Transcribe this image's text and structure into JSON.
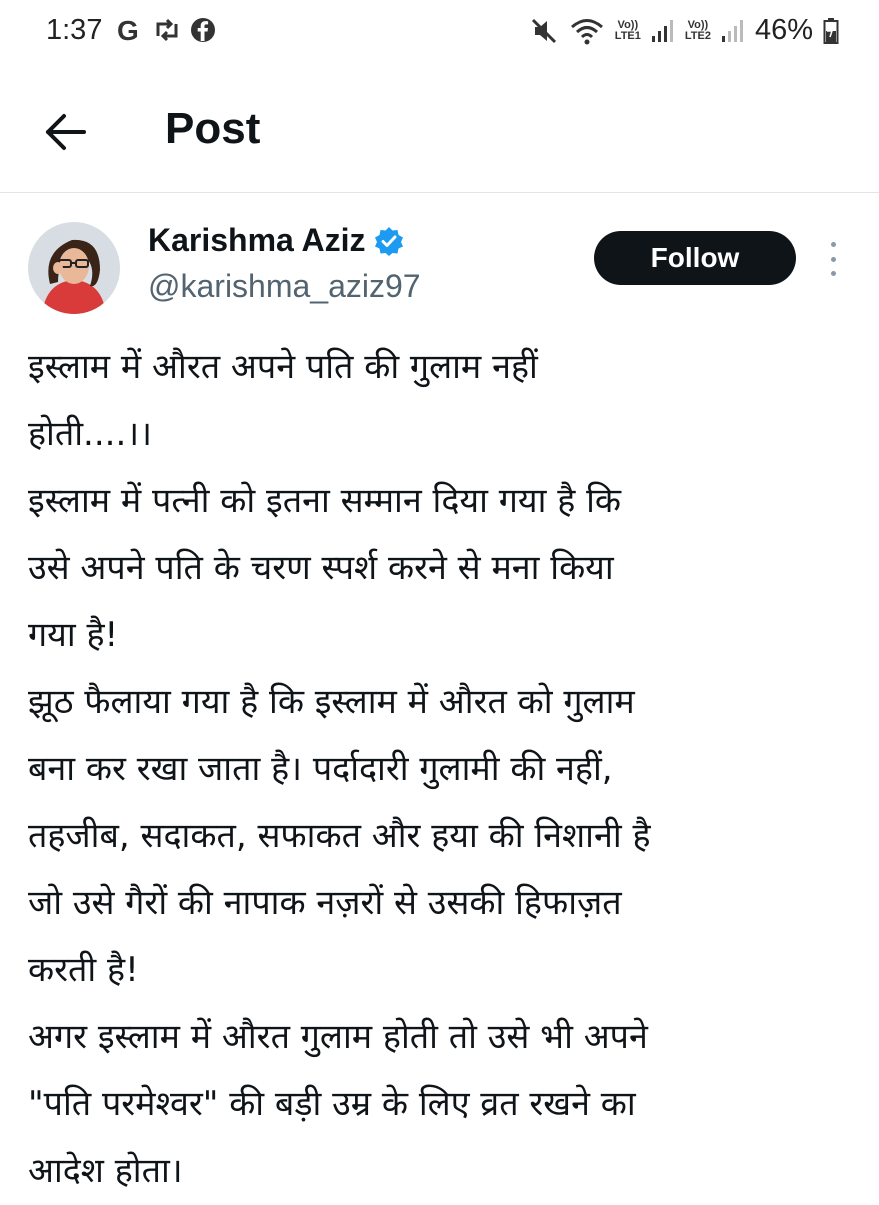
{
  "status_bar": {
    "time": "1:37",
    "left_icons": [
      "google-icon",
      "sync-icon",
      "facebook-icon"
    ],
    "lte1": [
      "Vo))",
      "LTE1"
    ],
    "lte2": [
      "Vo))",
      "LTE2"
    ],
    "battery": "46%"
  },
  "header": {
    "title": "Post"
  },
  "author": {
    "name": "Karishma Aziz",
    "handle": "@karishma_aziz97",
    "verified": true
  },
  "follow_label": "Follow",
  "post_lines": [
    "इस्लाम में औरत अपने पति की गुलाम नहीं",
    "होती....।।",
    "इस्लाम में पत्नी को इतना सम्मान दिया गया है कि",
    "उसे अपने पति के चरण स्पर्श करने से मना किया",
    "गया है!",
    "झूठ फैलाया गया है कि इस्लाम में औरत को गुलाम",
    "बना कर रखा जाता है। पर्दादारी गुलामी की नहीं,",
    "तहजीब, सदाकत, सफाकत और हया की निशानी है",
    "जो उसे गैरों की नापाक नज़रों से उसकी हिफाज़त",
    "करती है!",
    "अगर इस्लाम में औरत गुलाम होती तो उसे भी अपने",
    "\"पति परमेश्वर\" की बड़ी उम्र के लिए व्रत रखने का",
    "आदेश होता।"
  ],
  "colors": {
    "text": "#0f1419",
    "secondary": "#536471",
    "verified": "#1d9bf0",
    "follow_bg": "#0f1419"
  }
}
